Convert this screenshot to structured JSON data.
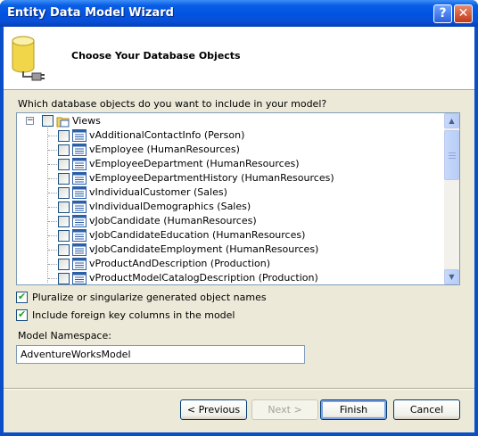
{
  "window": {
    "title": "Entity Data Model Wizard"
  },
  "titlebar": {
    "help_label": "?",
    "close_label": "✕"
  },
  "header": {
    "title": "Choose Your Database Objects"
  },
  "prompt": "Which database objects do you want to include in your model?",
  "tree": {
    "root_label": "Views",
    "items": [
      "vAdditionalContactInfo (Person)",
      "vEmployee (HumanResources)",
      "vEmployeeDepartment (HumanResources)",
      "vEmployeeDepartmentHistory (HumanResources)",
      "vIndividualCustomer (Sales)",
      "vIndividualDemographics (Sales)",
      "vJobCandidate (HumanResources)",
      "vJobCandidateEducation (HumanResources)",
      "vJobCandidateEmployment (HumanResources)",
      "vProductAndDescription (Production)",
      "vProductModelCatalogDescription (Production)"
    ]
  },
  "options": {
    "pluralize": {
      "label": "Pluralize or singularize generated object names",
      "checked": true
    },
    "foreign_keys": {
      "label": "Include foreign key columns in the model",
      "checked": true
    }
  },
  "namespace": {
    "label": "Model Namespace:",
    "value": "AdventureWorksModel"
  },
  "buttons": {
    "previous": "< Previous",
    "next": "Next >",
    "finish": "Finish",
    "cancel": "Cancel"
  },
  "colors": {
    "titlebar": "#0054e3",
    "dialog": "#ece9d8",
    "check": "#21a121"
  }
}
